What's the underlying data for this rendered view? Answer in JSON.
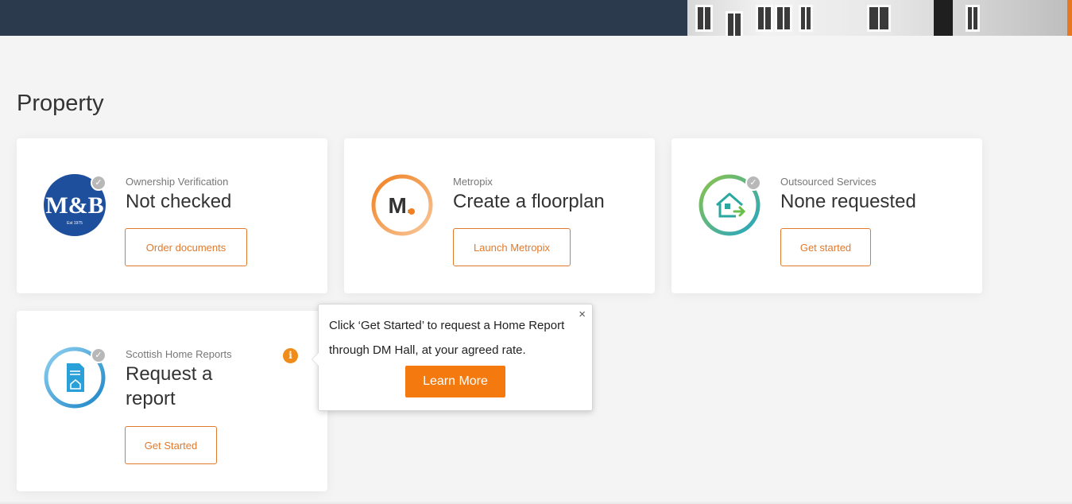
{
  "page": {
    "title": "Property"
  },
  "colors": {
    "accent": "#e07a2e",
    "header": "#2b3a4d",
    "tooltip_button": "#f47a10"
  },
  "cards": [
    {
      "logo": "m-and-b-logo",
      "logo_text": "M&B",
      "logo_subtext": "Est 1975",
      "kicker": "Ownership Verification",
      "headline": "Not checked",
      "button": "Order documents"
    },
    {
      "logo": "metropix-logo",
      "logo_text": "M.",
      "kicker": "Metropix",
      "headline": "Create a floorplan",
      "button": "Launch Metropix"
    },
    {
      "logo": "house-arrow-logo",
      "kicker": "Outsourced Services",
      "headline": "None requested",
      "button": "Get started"
    },
    {
      "logo": "home-report-logo",
      "kicker": "Scottish Home Reports",
      "headline": "Request a report",
      "button": "Get Started"
    }
  ],
  "tooltip": {
    "text": "Click ‘Get Started’ to request a Home Report through DM Hall, at your agreed rate.",
    "button": "Learn More",
    "close": "×"
  },
  "icons": {
    "check": "✓",
    "info": "i"
  }
}
